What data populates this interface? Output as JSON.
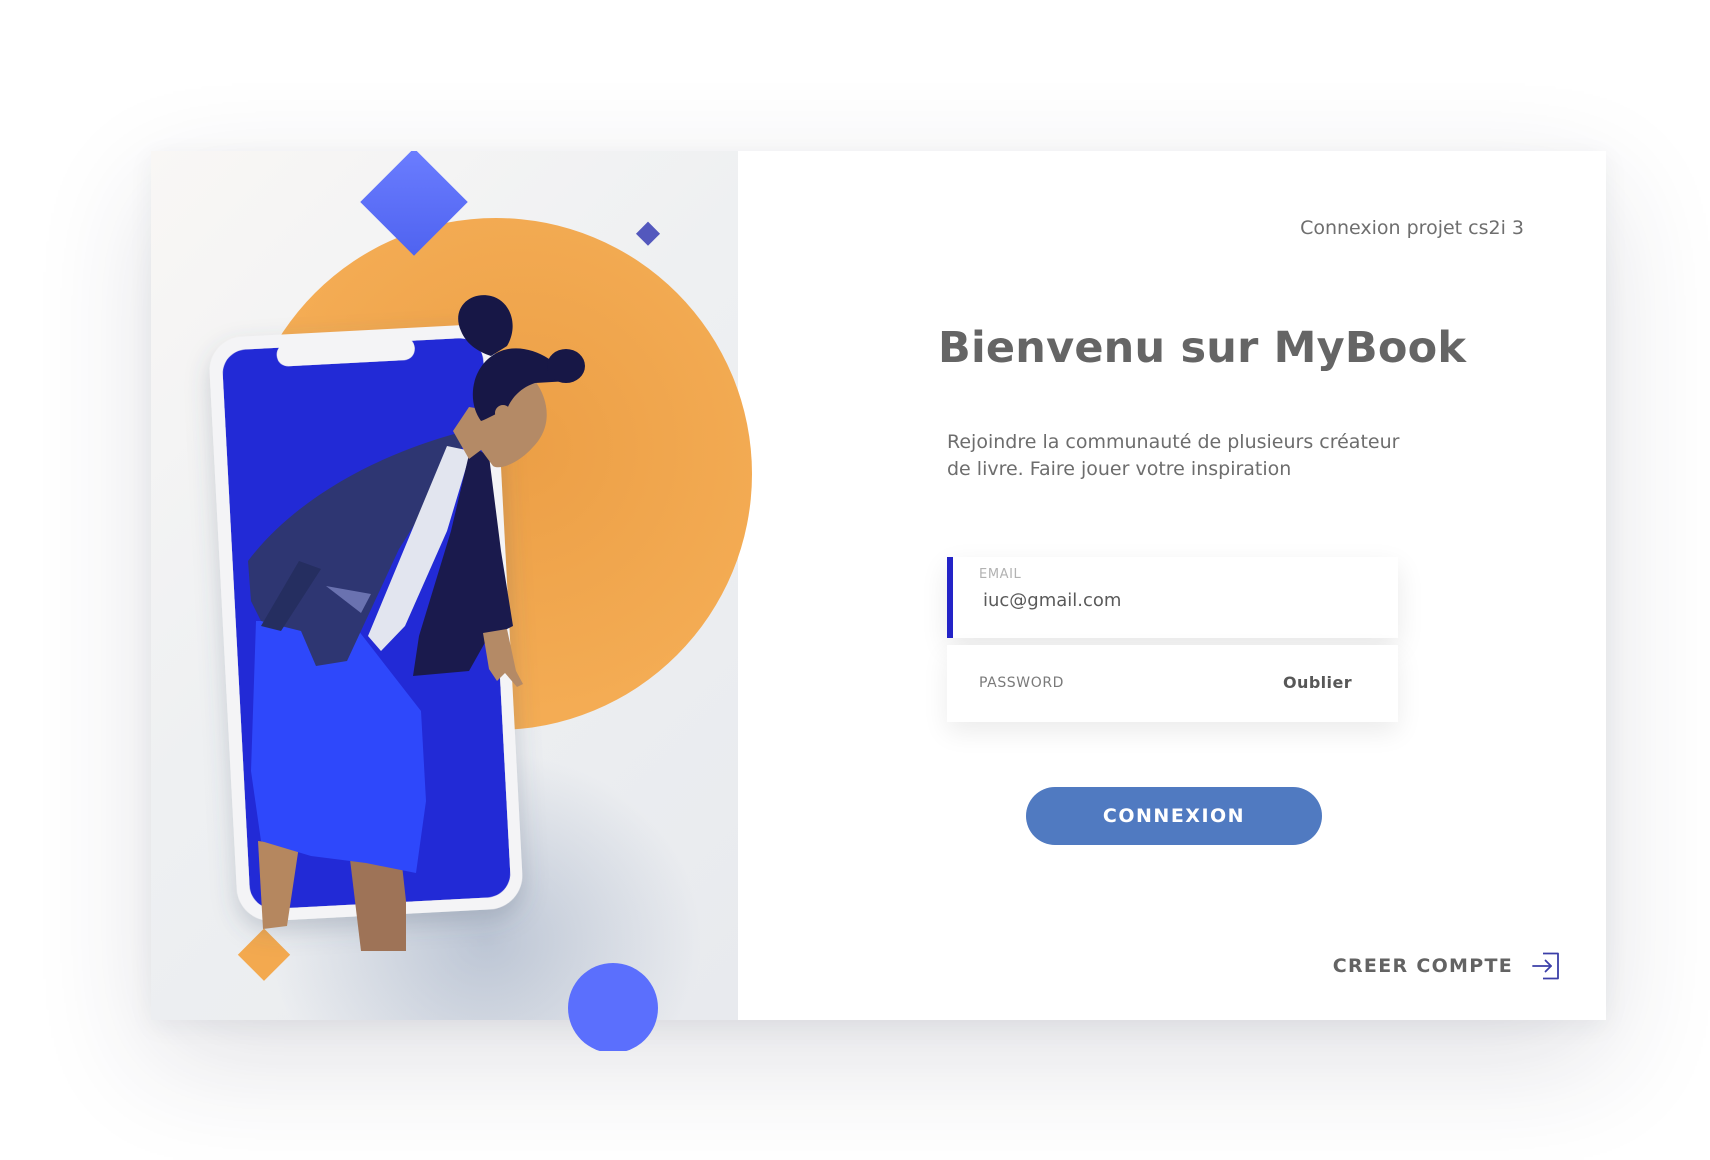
{
  "header": {
    "project_label": "Connexion projet cs2i 3"
  },
  "main": {
    "title": "Bienvenu sur MyBook",
    "intro": "Rejoindre la communauté de plusieurs créateur de livre. Faire jouer votre inspiration"
  },
  "form": {
    "email": {
      "label": "EMAIL",
      "value": "iuc@gmail.com"
    },
    "password": {
      "label": "PASSWORD",
      "value": "",
      "forgot_label": "Oublier"
    },
    "submit_label": "CONNEXION"
  },
  "footer": {
    "create_account_label": "CREER COMPTE",
    "create_account_icon": "login-icon"
  },
  "illustration": {
    "figure": "woman-leaning-out-of-phone",
    "colors": {
      "orange": "#f5ad55",
      "royal_blue": "#5b6ffd",
      "phone_screen": "#2329d6",
      "navy": "#2e3672",
      "skirt": "#2e48fb",
      "hair": "#171746",
      "skin": "#b88a66"
    }
  },
  "theme": {
    "accent": "#2323c7",
    "button": "#507ac1",
    "text": "#656565"
  }
}
